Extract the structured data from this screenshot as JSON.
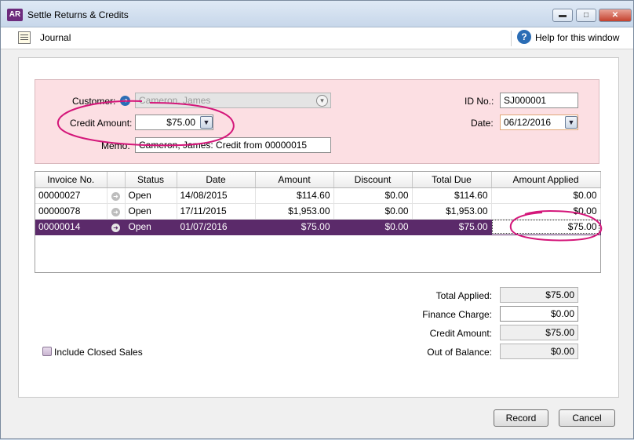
{
  "window": {
    "app_icon": "AR",
    "title": "Settle Returns & Credits",
    "minimize": "▬",
    "maximize": "□",
    "close": "✕"
  },
  "toolbar": {
    "journal_label": "Journal",
    "help_icon": "?",
    "help_label": "Help for this window"
  },
  "header": {
    "customer_label": "Customer:",
    "customer_value": "Cameron, James",
    "credit_amount_label": "Credit Amount:",
    "credit_amount_value": "$75.00",
    "memo_label": "Memo:",
    "memo_value": "Cameron, James: Credit from 00000015",
    "id_label": "ID No.:",
    "id_value": "SJ000001",
    "date_label": "Date:",
    "date_value": "06/12/2016"
  },
  "grid": {
    "columns": [
      "Invoice No.",
      "",
      "Status",
      "Date",
      "Amount",
      "Discount",
      "Total Due",
      "Amount Applied"
    ],
    "rows": [
      {
        "invoice": "00000027",
        "status": "Open",
        "date": "14/08/2015",
        "amount": "$114.60",
        "discount": "$0.00",
        "total_due": "$114.60",
        "applied": "$0.00"
      },
      {
        "invoice": "00000078",
        "status": "Open",
        "date": "17/11/2015",
        "amount": "$1,953.00",
        "discount": "$0.00",
        "total_due": "$1,953.00",
        "applied": "$0.00"
      },
      {
        "invoice": "00000014",
        "status": "Open",
        "date": "01/07/2016",
        "amount": "$75.00",
        "discount": "$0.00",
        "total_due": "$75.00",
        "applied": "$75.00"
      }
    ]
  },
  "totals": {
    "total_applied_label": "Total Applied:",
    "total_applied_value": "$75.00",
    "finance_charge_label": "Finance Charge:",
    "finance_charge_value": "$0.00",
    "credit_amount_label": "Credit Amount:",
    "credit_amount_value": "$75.00",
    "out_of_balance_label": "Out of Balance:",
    "out_of_balance_value": "$0.00"
  },
  "options": {
    "include_closed_label": "Include Closed Sales"
  },
  "buttons": {
    "record": "Record",
    "cancel": "Cancel"
  },
  "colors": {
    "header_bg": "#fcdfe3",
    "selected_row": "#5b2a6a",
    "annotation": "#d4177a"
  }
}
